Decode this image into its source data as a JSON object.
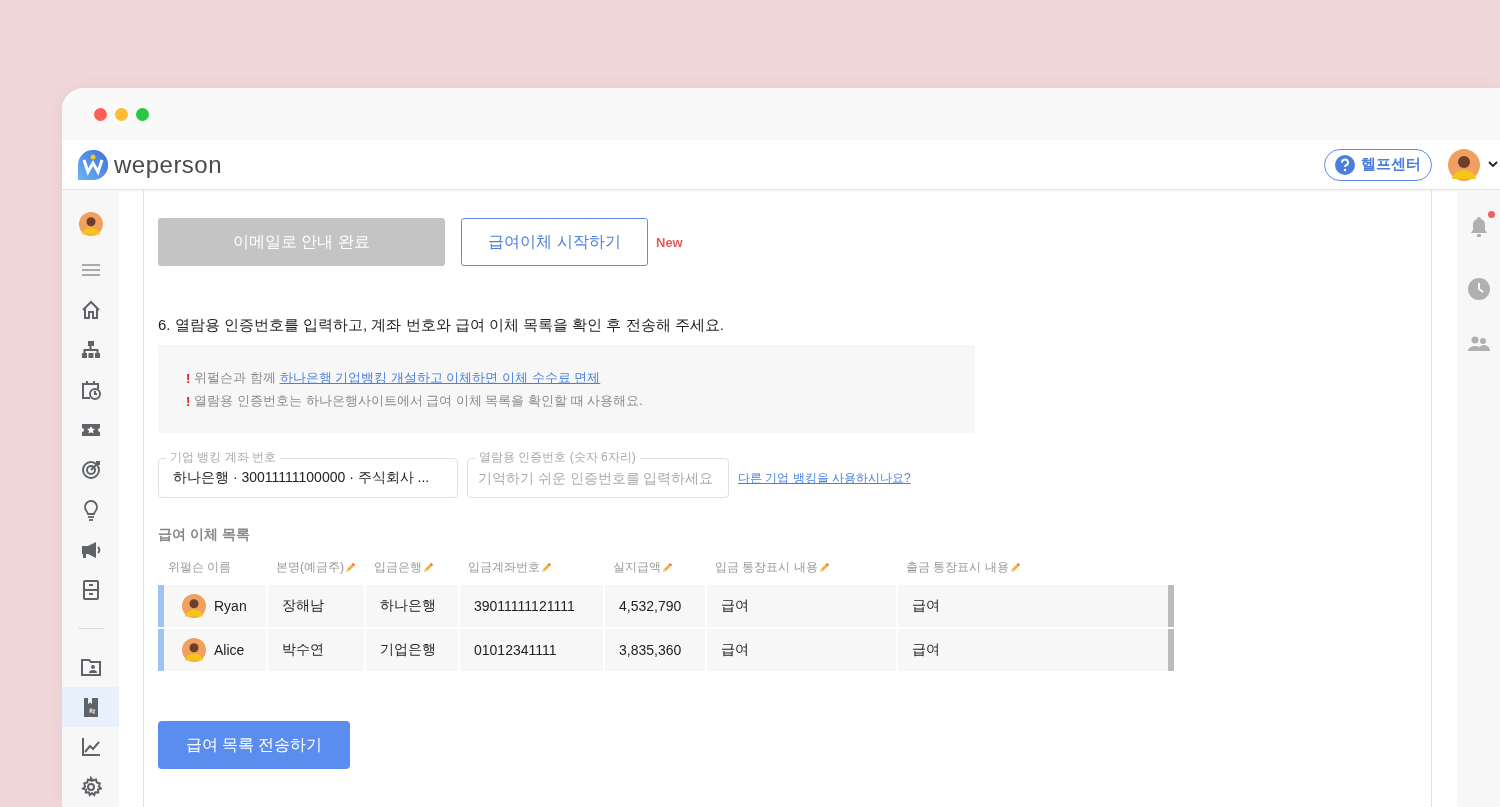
{
  "header": {
    "logo_text": "weperson",
    "help_button": "헬프센터"
  },
  "sidebar": {
    "items": [
      {
        "selected": false
      },
      {
        "selected": false
      },
      {
        "selected": false
      },
      {
        "selected": false
      },
      {
        "selected": false
      },
      {
        "selected": false
      },
      {
        "selected": false
      },
      {
        "selected": false
      },
      {
        "selected": false
      },
      {
        "selected": false
      },
      {
        "selected": true
      },
      {
        "selected": false
      },
      {
        "selected": false
      }
    ]
  },
  "right_rail": {
    "notification_unread": true
  },
  "actions": [
    {
      "label": "이메일로 안내 완료",
      "disabled": true
    },
    {
      "label": "급여이체 시작하기",
      "disabled": false
    }
  ],
  "new_badge": "New",
  "step_text": "6. 열람용 인증번호를 입력하고, 계좌 번호와 급여 이체 목록을 확인 후 전송해 주세요.",
  "notices": [
    {
      "mark": "!",
      "before": "위펄슨과 함께 ",
      "link": "하나은행 기업뱅킹 개설하고 이체하면 이체 수수료 면제"
    },
    {
      "mark": "!",
      "before": "열람용 인증번호는 하나은행사이트에서 급여 이체 목록을 확인할 때 사용해요."
    }
  ],
  "fields": [
    {
      "label": "기업 뱅킹 계좌 번호",
      "value": "하나은행 · 30011111100000 · 주식회사 ..."
    },
    {
      "label": "열람용 인증번호 (숫자 6자리)",
      "placeholder": "기억하기 쉬운 인증번호를 입력하세요"
    }
  ],
  "other_bank_link": "다른 기업 뱅킹을 사용하시나요?",
  "table": {
    "title": "급여 이체 목록",
    "columns": [
      {
        "label": "위펄슨 이름",
        "editable": false
      },
      {
        "label": "본명(예금주)",
        "editable": true
      },
      {
        "label": "입금은행",
        "editable": true
      },
      {
        "label": "입금계좌번호",
        "editable": true
      },
      {
        "label": "실지급액",
        "editable": true
      },
      {
        "label": "입금 통장표시 내용",
        "editable": true
      },
      {
        "label": "출금 통장표시 내용",
        "editable": true
      }
    ],
    "rows": [
      {
        "cells": [
          "Ryan",
          "장해남",
          "하나은행",
          "39011111121111",
          "4,532,790",
          "급여",
          "급여"
        ]
      },
      {
        "cells": [
          "Alice",
          "박수연",
          "기업은행",
          "01012341111",
          "3,835,360",
          "급여",
          "급여"
        ]
      }
    ]
  },
  "submit_button": "급여 목록 전송하기"
}
